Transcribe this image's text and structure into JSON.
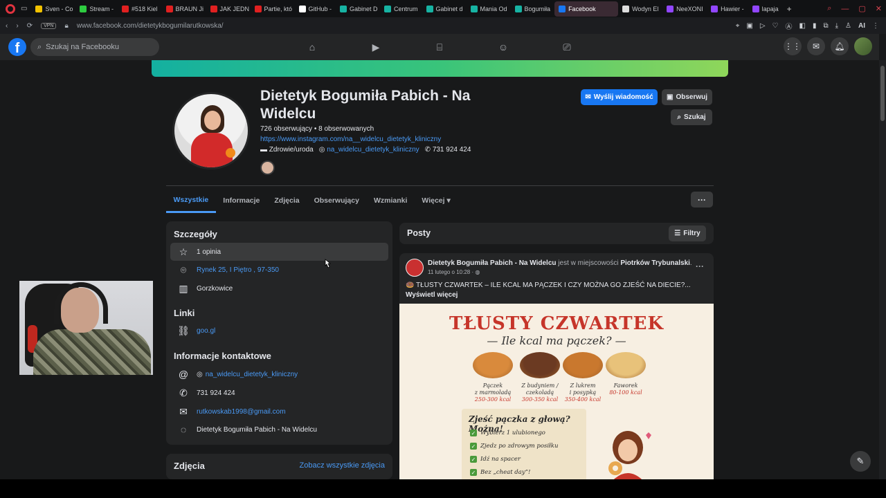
{
  "browser": {
    "tabs": [
      {
        "label": "Sven - Co",
        "color": "#f2c200"
      },
      {
        "label": "Stream - ",
        "color": "#2ecc40"
      },
      {
        "label": "#518 Kiel",
        "color": "#e02020"
      },
      {
        "label": "BRAUN Ji",
        "color": "#e02020"
      },
      {
        "label": "JAK JEDN",
        "color": "#e02020"
      },
      {
        "label": "Partie, któ",
        "color": "#e02020"
      },
      {
        "label": "GitHub - ",
        "color": "#ffffff"
      },
      {
        "label": "Gabinet D",
        "color": "#17b3a3"
      },
      {
        "label": "Centrum ",
        "color": "#17b3a3"
      },
      {
        "label": "Gabinet d",
        "color": "#17b3a3"
      },
      {
        "label": "Mania Od",
        "color": "#17b3a3"
      },
      {
        "label": "Bogumiła",
        "color": "#17b3a3"
      },
      {
        "label": "Facebook",
        "color": "#1877f2",
        "active": true
      },
      {
        "label": "Wodyn El",
        "color": "#dddddd"
      },
      {
        "label": "NeeXONI",
        "color": "#9146ff"
      },
      {
        "label": "Hawier - ",
        "color": "#9146ff"
      },
      {
        "label": "lapaja",
        "color": "#9146ff"
      }
    ],
    "url": "www.facebook.com/dietetykbogumilarutkowska/",
    "vpn_label": "VPN",
    "ai_label": "AI"
  },
  "fb_nav": {
    "logo": "f",
    "search_placeholder": "Szukaj na Facebooku"
  },
  "profile": {
    "name": "Dietetyk Bogumiła Pabich - Na Widelcu",
    "followers_line": "726 obserwujący • 8 obserwowanych",
    "instagram_url": "https://www.instagram.com/na__widelcu_dietetyk_kliniczny",
    "category": "Zdrowie/uroda",
    "ig_handle": "na_widelcu_dietetyk_kliniczny",
    "phone": "731 924 424",
    "btn_message": "Wyślij wiadomość",
    "btn_follow": "Obserwuj",
    "btn_search": "Szukaj"
  },
  "tabs": {
    "items": [
      "Wszystkie",
      "Informacje",
      "Zdjęcia",
      "Obserwujący",
      "Wzmianki",
      "Więcej"
    ],
    "more_caret": "▾",
    "dots": "···"
  },
  "details": {
    "title": "Szczegóły",
    "review": "1 opinia",
    "address": "Rynek 25, I Piętro , 97-350",
    "city": "Gorzkowice",
    "links_title": "Linki",
    "link": "goo.gl",
    "contact_title": "Informacje kontaktowe",
    "contact_ig": "na_widelcu_dietetyk_kliniczny",
    "contact_phone": "731 924 424",
    "contact_email": "rutkowskab1998@gmail.com",
    "contact_messenger": "Dietetyk Bogumiła Pabich - Na Widelcu"
  },
  "photos": {
    "title": "Zdjęcia",
    "see_all": "Zobacz wszystkie zdjęcia"
  },
  "posts": {
    "title": "Posty",
    "filter": "Filtry",
    "post": {
      "author": "Dietetyk Bogumiła Pabich - Na Widelcu",
      "location_prefix": " jest w miejscowości ",
      "location": "Piotrków Trybunalski",
      "date": "11 lutego o 10:28 · ",
      "text": "🍩 TŁUSTY CZWARTEK – ILE KCAL MA PĄCZEK I CZY MOŻNA GO ZJEŚĆ NA DIECIE?... ",
      "see_more": "Wyświetl więcej",
      "image": {
        "title": "TŁUSTY CZWARTEK",
        "subtitle": "— Ile kcal ma pączek? —",
        "donuts": [
          {
            "name": "Pączek\nz marmoladą",
            "kcal": "250-300 kcal",
            "color": "#d98a3c"
          },
          {
            "name": "Z budyniem /\nczekoladą",
            "kcal": "300-350 kcal",
            "color": "#6b3a22"
          },
          {
            "name": "Z lukrem\ni posypką",
            "kcal": "350-400 kcal",
            "color": "#c9782e"
          },
          {
            "name": "Faworek",
            "kcal": "80-100 kcal",
            "color": "#e8c27a"
          }
        ],
        "box_title": "Zjeść pączka z głową? Można!",
        "checklist": [
          "Wybierz 1 ulubionego",
          "Zjedz po zdrowym posiłku",
          "Idź na spacer",
          "Bez „cheat day”!"
        ]
      }
    }
  }
}
